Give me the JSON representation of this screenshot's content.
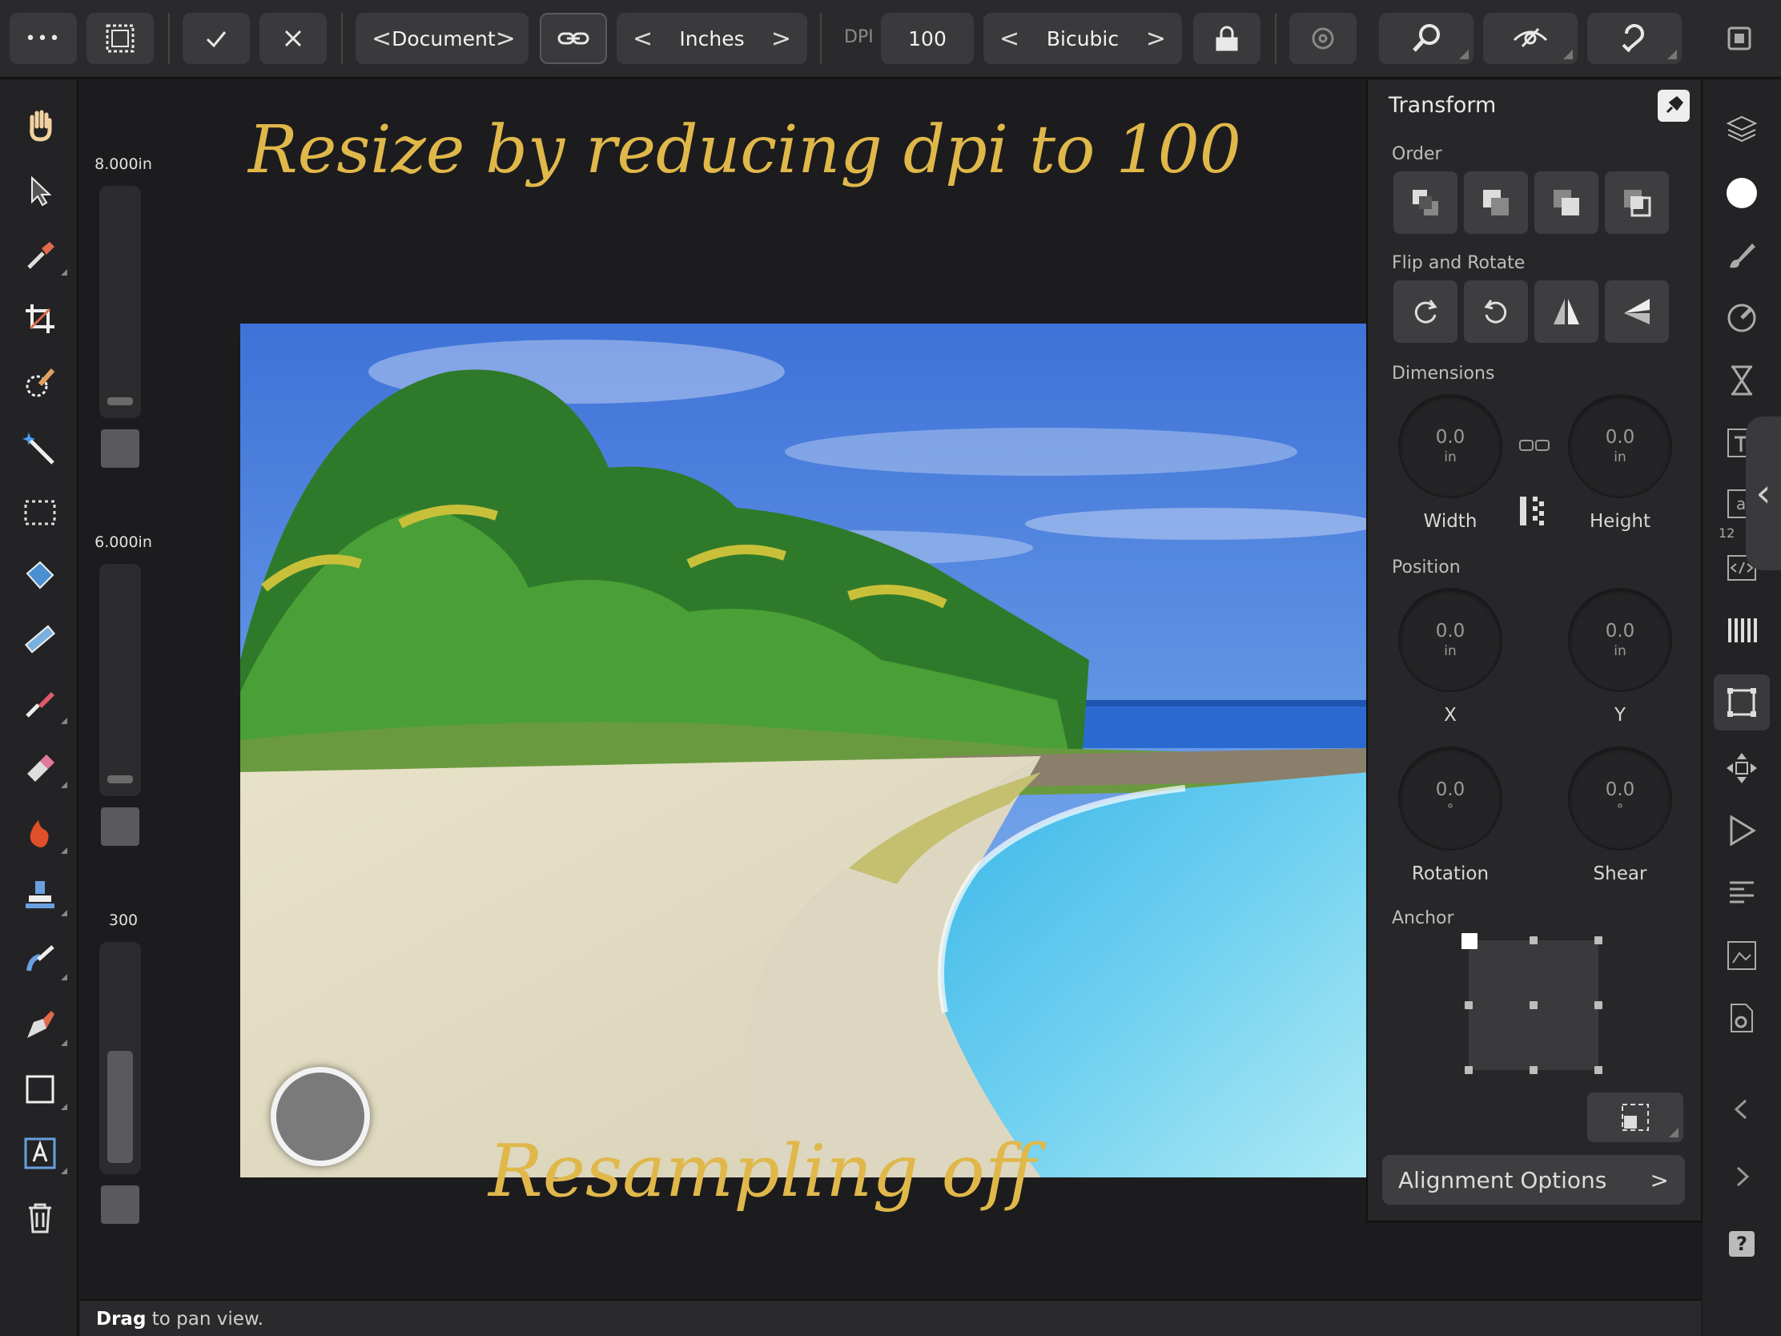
{
  "toolbar": {
    "more": "•••",
    "document_label": "Document",
    "units_label": "Inches",
    "dpi_label": "DPI",
    "dpi_value": "100",
    "resample_label": "Bicubic",
    "chev_left": "<",
    "chev_right": ">"
  },
  "sliders": {
    "top_label": "8.000in",
    "mid_label": "6.000in",
    "bottom_label": "300"
  },
  "canvas": {
    "note_top": "Resize by reducing dpi to 100",
    "note_bottom": "Resampling off"
  },
  "panel": {
    "title": "Transform",
    "order_label": "Order",
    "flip_label": "Flip and Rotate",
    "dimensions_label": "Dimensions",
    "width": {
      "value": "0.0",
      "unit": "in",
      "label": "Width"
    },
    "height": {
      "value": "0.0",
      "unit": "in",
      "label": "Height"
    },
    "position_label": "Position",
    "x": {
      "value": "0.0",
      "unit": "in",
      "label": "X"
    },
    "y": {
      "value": "0.0",
      "unit": "in",
      "label": "Y"
    },
    "rotation": {
      "value": "0.0",
      "unit": "°",
      "label": "Rotation"
    },
    "shear": {
      "value": "0.0",
      "unit": "°",
      "label": "Shear"
    },
    "anchor_label": "Anchor",
    "alignment_options": "Alignment Options",
    "alignment_chevron": ">"
  },
  "studio": {
    "char_count": "12",
    "help": "?"
  },
  "status": {
    "bold": "Drag",
    "rest": " to pan view."
  },
  "colors": {
    "accent_handwriting": "#e0b84a",
    "panel_bg": "#27272a",
    "toolbar_bg": "#2a2a2c"
  }
}
